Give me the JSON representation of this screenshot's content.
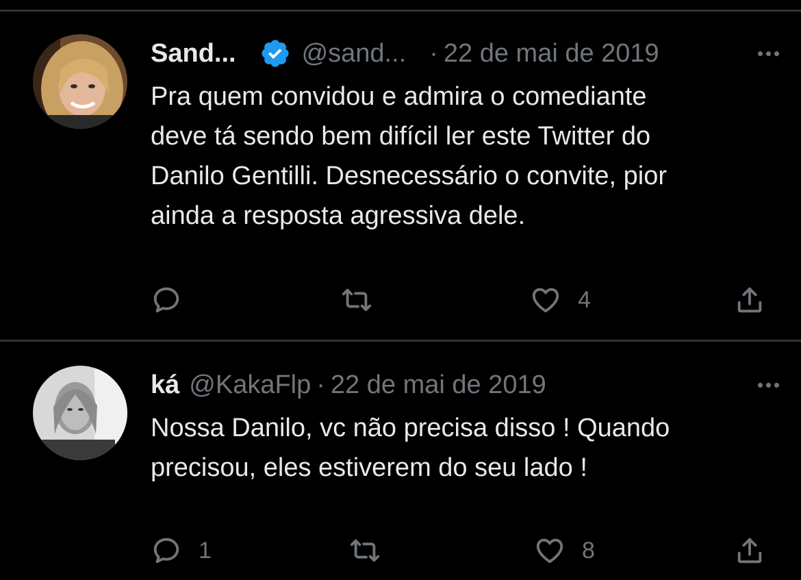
{
  "tweets": [
    {
      "name": "Sand...",
      "handle": "@sand...",
      "separator": "·",
      "date": "22 de mai de 2019",
      "verified": true,
      "text_lines": [
        "Pra quem convidou e admira o comediante",
        "deve tá sendo bem difícil ler este Twitter do",
        "Danilo Gentilli. Desnecessário o convite, pior",
        "ainda a resposta agressiva dele."
      ],
      "reply_count": "",
      "retweet_count": "",
      "like_count": "4"
    },
    {
      "name": "ká",
      "handle": "@KakaFlp",
      "separator": "·",
      "date": "22 de mai de 2019",
      "verified": false,
      "text_lines": [
        "Nossa Danilo, vc não precisa disso ! Quando",
        "precisou, eles estiverem do seu lado !"
      ],
      "reply_count": "1",
      "retweet_count": "",
      "like_count": "8"
    }
  ],
  "colors": {
    "background": "#000000",
    "text": "#e7e9ea",
    "muted": "#71767b",
    "divider": "#2f3336",
    "verified": "#1d9bf0"
  },
  "icons": {
    "reply": "reply-icon",
    "retweet": "retweet-icon",
    "like": "heart-icon",
    "share": "share-icon",
    "more": "more-icon",
    "verified": "verified-badge-icon"
  }
}
